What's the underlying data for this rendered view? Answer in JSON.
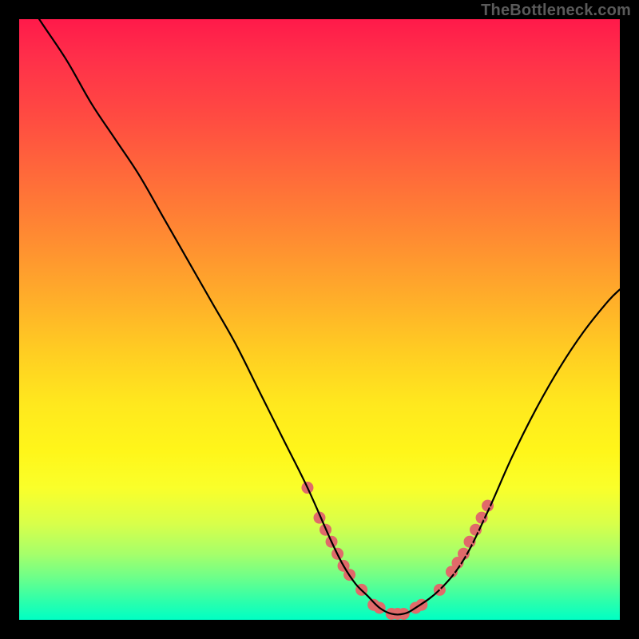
{
  "watermark": "TheBottleneck.com",
  "chart_data": {
    "type": "line",
    "title": "",
    "xlabel": "",
    "ylabel": "",
    "xlim": [
      0,
      100
    ],
    "ylim": [
      0,
      100
    ],
    "series": [
      {
        "name": "bottleneck-curve",
        "x": [
          0,
          4,
          8,
          12,
          16,
          20,
          24,
          28,
          32,
          36,
          40,
          44,
          48,
          52,
          54,
          56,
          58,
          60,
          62,
          64,
          66,
          70,
          74,
          78,
          82,
          86,
          90,
          94,
          98,
          100
        ],
        "y": [
          105,
          99,
          93,
          86,
          80,
          74,
          67,
          60,
          53,
          46,
          38,
          30,
          22,
          13,
          9,
          6,
          4,
          2,
          1,
          1,
          2,
          5,
          10,
          18,
          27,
          35,
          42,
          48,
          53,
          55
        ]
      }
    ],
    "markers": {
      "name": "highlight-dots",
      "color": "#e06a6a",
      "points": [
        {
          "x": 48,
          "y": 22
        },
        {
          "x": 50,
          "y": 17
        },
        {
          "x": 51,
          "y": 15
        },
        {
          "x": 52,
          "y": 13
        },
        {
          "x": 53,
          "y": 11
        },
        {
          "x": 54,
          "y": 9
        },
        {
          "x": 55,
          "y": 7.5
        },
        {
          "x": 57,
          "y": 5
        },
        {
          "x": 59,
          "y": 2.5
        },
        {
          "x": 60,
          "y": 2
        },
        {
          "x": 62,
          "y": 1
        },
        {
          "x": 63,
          "y": 1
        },
        {
          "x": 64,
          "y": 1
        },
        {
          "x": 66,
          "y": 2
        },
        {
          "x": 67,
          "y": 2.5
        },
        {
          "x": 70,
          "y": 5
        },
        {
          "x": 72,
          "y": 8
        },
        {
          "x": 73,
          "y": 9.5
        },
        {
          "x": 74,
          "y": 11
        },
        {
          "x": 75,
          "y": 13
        },
        {
          "x": 76,
          "y": 15
        },
        {
          "x": 77,
          "y": 17
        },
        {
          "x": 78,
          "y": 19
        }
      ]
    }
  }
}
